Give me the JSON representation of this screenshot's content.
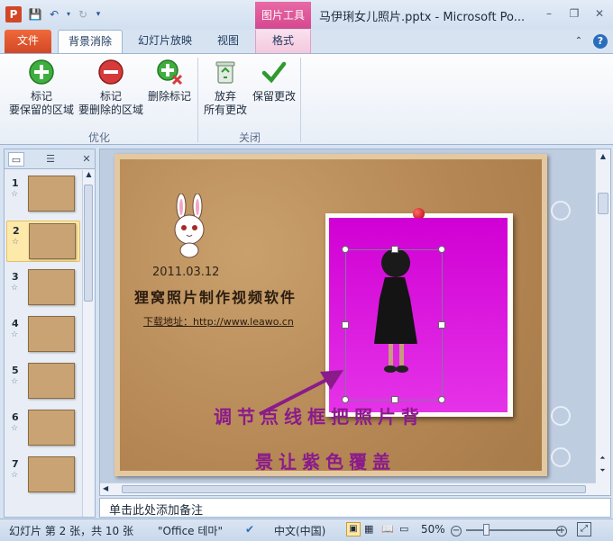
{
  "window": {
    "title": "马伊琍女儿照片.pptx - Microsoft Po...",
    "context_tab_group": "图片工具"
  },
  "tabs": {
    "file": "文件",
    "background_removal": "背景消除",
    "slideshow": "幻灯片放映",
    "view": "视图",
    "format": "格式"
  },
  "ribbon": {
    "mark_keep": {
      "line1": "标记",
      "line2": "要保留的区域"
    },
    "mark_remove": {
      "line1": "标记",
      "line2": "要删除的区域"
    },
    "delete_mark": {
      "line1": "删除标记"
    },
    "discard": {
      "line1": "放弃",
      "line2": "所有更改"
    },
    "keep_changes": {
      "line1": "保留更改"
    },
    "group_refine": "优化",
    "group_close": "关闭"
  },
  "thumbnails": [
    {
      "num": "1",
      "selected": false
    },
    {
      "num": "2",
      "selected": true
    },
    {
      "num": "3",
      "selected": false
    },
    {
      "num": "4",
      "selected": false
    },
    {
      "num": "5",
      "selected": false
    },
    {
      "num": "6",
      "selected": false
    },
    {
      "num": "7",
      "selected": false
    }
  ],
  "slide": {
    "date": "2011.03.12",
    "title": "狸窝照片制作视频软件",
    "download": "下载地址：http://www.leawo.cn",
    "annotation_line1": "调节点线框把照片背",
    "annotation_line2": "景让紫色覆盖"
  },
  "notes": {
    "placeholder": "单击此处添加备注"
  },
  "status": {
    "slide_info": "幻灯片 第 2 张，共 10 张",
    "theme": "\"Office 테마\"",
    "language": "中文(中国)",
    "zoom": "50%"
  },
  "colors": {
    "file_tab": "#d24726",
    "context_tab": "#d6478f",
    "removal_magenta": "#d000d4",
    "annotation_text": "#8a1b8a"
  }
}
